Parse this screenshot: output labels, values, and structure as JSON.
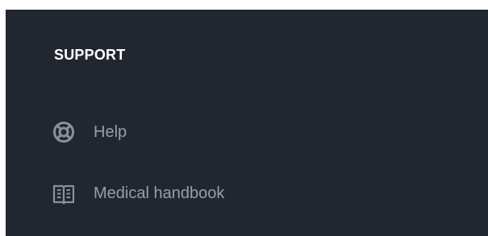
{
  "sidebar": {
    "section_title": "SUPPORT",
    "items": [
      {
        "label": "Help",
        "icon": "lifebuoy-icon"
      },
      {
        "label": "Medical handbook",
        "icon": "book-icon"
      }
    ]
  },
  "colors": {
    "background": "#22262e",
    "title": "#ffffff",
    "item_text": "#9a9ea7",
    "icon": "#8c9099"
  }
}
